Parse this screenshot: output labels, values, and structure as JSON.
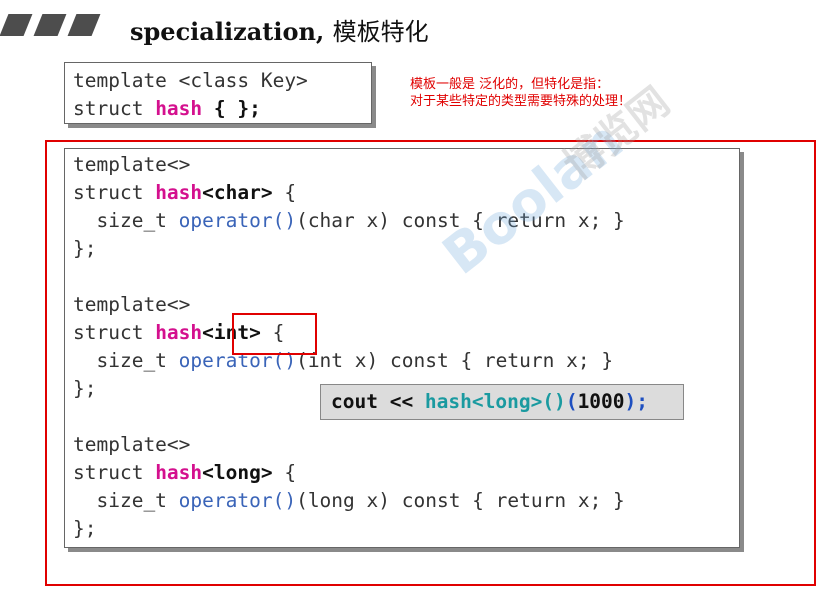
{
  "header": {
    "title_en": "specialization,",
    "title_cn": "模板特化"
  },
  "box1": {
    "line1": "template <class Key>",
    "line2_a": "struct ",
    "line2_kw": "hash",
    "line2_b": " { };"
  },
  "note": {
    "line1": "模板一般是 泛化的，但特化是指：",
    "line2": "对于某些特定的类型需要特殊的处理！"
  },
  "spec_char": {
    "l1": "template<>",
    "l2_a": "struct ",
    "l2_kw": "hash",
    "l2_type": "<char>",
    "l2_b": " {",
    "l3_a": "  size_t ",
    "l3_op": "operator()",
    "l3_b": "(char x) const { return x; }",
    "l4": "};"
  },
  "spec_int": {
    "l1": "template<>",
    "l2_a": "struct ",
    "l2_kw": "hash",
    "l2_type": "<int>",
    "l2_b": " {",
    "l3_a": "  size_t ",
    "l3_op": "operator()",
    "l3_b": "(int x) const { return x; }",
    "l4": "};"
  },
  "spec_long": {
    "l1": "template<>",
    "l2_a": "struct ",
    "l2_kw": "hash",
    "l2_type": "<long>",
    "l2_b": " {",
    "l3_a": "  size_t ",
    "l3_op": "operator()",
    "l3_b": "(long x) const { return x; }",
    "l4": "};"
  },
  "callout": {
    "a": "cout << ",
    "b": "hash<long>()",
    "c": "(",
    "d": "1000",
    "e": ");"
  },
  "watermark": {
    "logo": "Boolan",
    "cn": "博览网"
  }
}
